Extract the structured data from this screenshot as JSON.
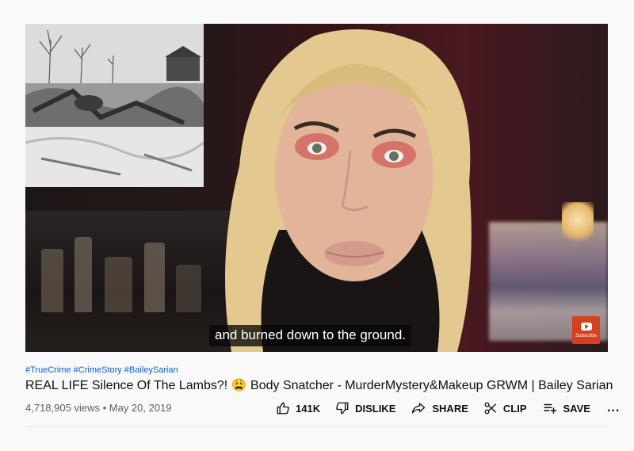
{
  "video": {
    "subtitle": "and burned down to the ground.",
    "subscribe_label": "Subscribe"
  },
  "hashtags": [
    "#TrueCrime",
    "#CrimeStory",
    "#BaileySarian"
  ],
  "title": "REAL LIFE Silence Of The Lambs?! 😩 Body Snatcher - MurderMystery&Makeup GRWM | Bailey Sarian",
  "meta": {
    "views": "4,718,905 views",
    "separator": "•",
    "date": "May 20, 2019"
  },
  "actions": {
    "like_count": "141K",
    "dislike_label": "DISLIKE",
    "share_label": "SHARE",
    "clip_label": "CLIP",
    "save_label": "SAVE",
    "more_label": "..."
  }
}
